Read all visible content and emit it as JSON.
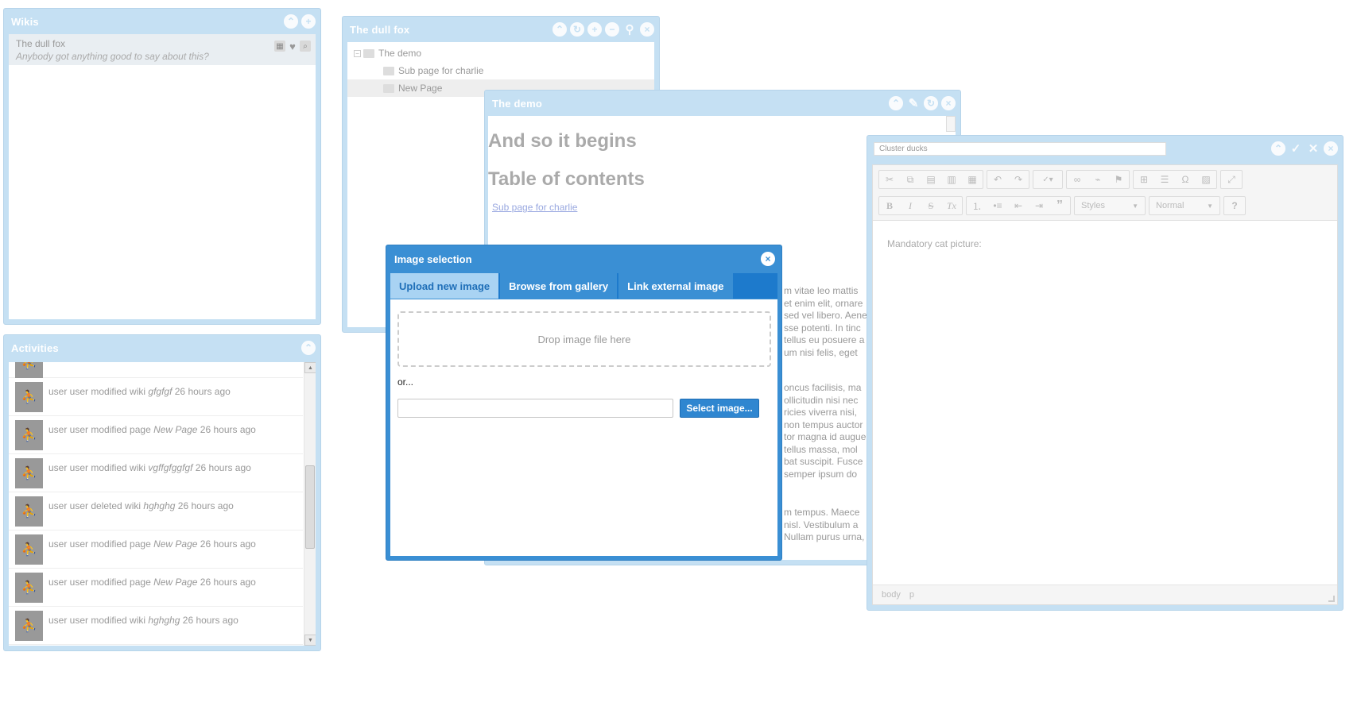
{
  "wikis_panel": {
    "title": "Wikis",
    "items": [
      {
        "name": "The dull fox",
        "description": "Anybody got anything good to say about this?"
      }
    ]
  },
  "activities_panel": {
    "title": "Activities",
    "items": [
      {
        "prefix": "user user modified wiki ",
        "target": "gfgfgf",
        "suffix": " 26 hours ago"
      },
      {
        "prefix": "user user modified page ",
        "target": "New Page",
        "suffix": " 26 hours ago"
      },
      {
        "prefix": "user user modified wiki ",
        "target": "vgffgfggfgf",
        "suffix": " 26 hours ago"
      },
      {
        "prefix": "user user deleted wiki ",
        "target": "hghghg",
        "suffix": " 26 hours ago"
      },
      {
        "prefix": "user user modified page ",
        "target": "New Page",
        "suffix": " 26 hours ago"
      },
      {
        "prefix": "user user modified page ",
        "target": "New Page",
        "suffix": " 26 hours ago"
      },
      {
        "prefix": "user user modified wiki ",
        "target": "hghghg",
        "suffix": " 26 hours ago"
      }
    ]
  },
  "tree_panel": {
    "title": "The dull fox",
    "root": "The demo",
    "children": [
      "Sub page for charlie",
      "New Page"
    ]
  },
  "demo_panel": {
    "title": "The demo",
    "heading1": "And so it begins",
    "heading2": "Table of contents",
    "toc_link": "Sub page for charlie",
    "para1": [
      "m vitae leo mattis",
      "et enim elit, ornare",
      "sed vel libero. Aene",
      "sse potenti. In tinc",
      "tellus eu posuere a",
      "um nisi felis, eget"
    ],
    "para2": [
      "oncus facilisis, ma",
      "ollicitudin nisi nec",
      "ricies viverra nisi,",
      "non tempus auctor",
      "tor magna id augue",
      "tellus massa, mol",
      "bat suscipit. Fusce",
      "semper ipsum do"
    ],
    "para3": [
      "m tempus. Maece",
      "nisl. Vestibulum a",
      "Nullam purus urna,"
    ]
  },
  "editor_panel": {
    "name_value": "Cluster ducks",
    "styles_select": "Styles",
    "format_select": "Normal",
    "content": "Mandatory cat picture:",
    "status_path": [
      "body",
      "p"
    ]
  },
  "image_dialog": {
    "title": "Image selection",
    "tabs": [
      "Upload new image",
      "Browse from gallery",
      "Link external image"
    ],
    "dropzone": "Drop image file here",
    "or_text": "or...",
    "select_button": "Select image..."
  },
  "colors": {
    "panel": "#c5e0f3",
    "dialog": "#3a8fd4",
    "dialog_tab_active": "#a9d3f3"
  }
}
